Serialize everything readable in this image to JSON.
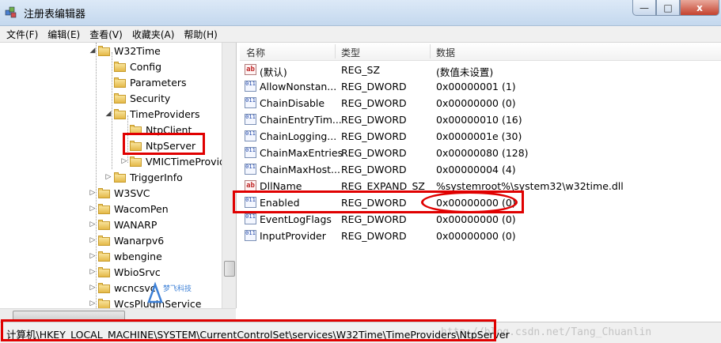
{
  "window": {
    "title": "注册表编辑器",
    "btn_min": "—",
    "btn_max": "□",
    "btn_close": "x"
  },
  "menu": [
    "文件(F)",
    "编辑(E)",
    "查看(V)",
    "收藏夹(A)",
    "帮助(H)"
  ],
  "tree": [
    {
      "label": "W32Time",
      "arrow": "◢"
    },
    {
      "label": "Config",
      "arrow": ""
    },
    {
      "label": "Parameters",
      "arrow": ""
    },
    {
      "label": "Security",
      "arrow": ""
    },
    {
      "label": "TimeProviders",
      "arrow": "◢"
    },
    {
      "label": "NtpClient",
      "arrow": ""
    },
    {
      "label": "NtpServer",
      "arrow": ""
    },
    {
      "label": "VMICTimeProvider",
      "arrow": "▷"
    },
    {
      "label": "TriggerInfo",
      "arrow": "▷"
    },
    {
      "label": "W3SVC",
      "arrow": "▷"
    },
    {
      "label": "WacomPen",
      "arrow": "▷"
    },
    {
      "label": "WANARP",
      "arrow": "▷"
    },
    {
      "label": "Wanarpv6",
      "arrow": "▷"
    },
    {
      "label": "wbengine",
      "arrow": "▷"
    },
    {
      "label": "WbioSrvc",
      "arrow": "▷"
    },
    {
      "label": "wcncsvc",
      "arrow": "▷"
    },
    {
      "label": "WcsPlugInService",
      "arrow": "▷"
    }
  ],
  "list": {
    "headers": {
      "name": "名称",
      "type": "类型",
      "data": "数据"
    },
    "rows": [
      {
        "name": "(默认)",
        "type": "REG_SZ",
        "data": "(数值未设置)",
        "icon": "ab"
      },
      {
        "name": "AllowNonstan...",
        "type": "REG_DWORD",
        "data": "0x00000001 (1)",
        "icon": "011"
      },
      {
        "name": "ChainDisable",
        "type": "REG_DWORD",
        "data": "0x00000000 (0)",
        "icon": "011"
      },
      {
        "name": "ChainEntryTim...",
        "type": "REG_DWORD",
        "data": "0x00000010 (16)",
        "icon": "011"
      },
      {
        "name": "ChainLogging...",
        "type": "REG_DWORD",
        "data": "0x0000001e (30)",
        "icon": "011"
      },
      {
        "name": "ChainMaxEntries",
        "type": "REG_DWORD",
        "data": "0x00000080 (128)",
        "icon": "011"
      },
      {
        "name": "ChainMaxHost...",
        "type": "REG_DWORD",
        "data": "0x00000004 (4)",
        "icon": "011"
      },
      {
        "name": "DllName",
        "type": "REG_EXPAND_SZ",
        "data": "%systemroot%\\system32\\w32time.dll",
        "icon": "ab"
      },
      {
        "name": "Enabled",
        "type": "REG_DWORD",
        "data": "0x00000000 (0)",
        "icon": "011"
      },
      {
        "name": "EventLogFlags",
        "type": "REG_DWORD",
        "data": "0x00000000 (0)",
        "icon": "011"
      },
      {
        "name": "InputProvider",
        "type": "REG_DWORD",
        "data": "0x00000000 (0)",
        "icon": "011"
      }
    ]
  },
  "statusbar": {
    "path": "计算机\\HKEY_LOCAL_MACHINE\\SYSTEM\\CurrentControlSet\\services\\W32Time\\TimeProviders\\NtpServer",
    "watermark": "http://blog.csdn.net/Tang_Chuanlin"
  },
  "logo": {
    "text": "梦飞科技"
  },
  "colors": {
    "highlight": "#e00000",
    "titlebar": "#c4d8ee"
  }
}
